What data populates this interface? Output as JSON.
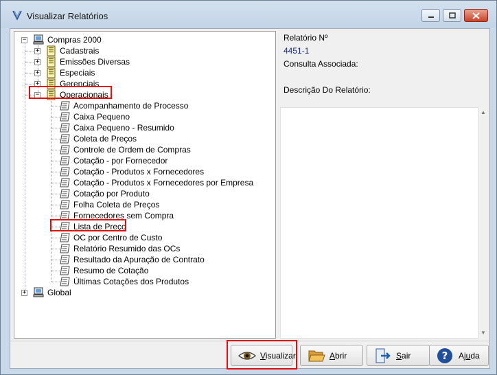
{
  "window": {
    "title": "Visualizar Relatórios"
  },
  "tree": {
    "root": {
      "label": "Compras 2000",
      "expander": "−"
    },
    "categories": [
      {
        "label": "Cadastrais",
        "expander": "+"
      },
      {
        "label": "Emissões Diversas",
        "expander": "+"
      },
      {
        "label": "Especiais",
        "expander": "+"
      },
      {
        "label": "Gerenciais",
        "expander": "+"
      },
      {
        "label": "Operacionais",
        "expander": "−",
        "highlighted": true
      }
    ],
    "reports": [
      "Acompanhamento de Processo",
      "Caixa Pequeno",
      "Caixa Pequeno - Resumido",
      "Coleta de Preços",
      "Controle de Ordem de Compras",
      "Cotação - por Fornecedor",
      "Cotação - Produtos x Fornecedores",
      "Cotação - Produtos x Fornecedores por Empresa",
      "Cotação por Produto",
      "Folha Coleta de Preços",
      "Fornecedores sem Compra",
      "Lista de Preço",
      "OC por Centro de Custo",
      "Relatório Resumido das OCs",
      "Resultado da Apuração de Contrato",
      "Resumo de Cotação",
      "Últimas Cotações dos Produtos"
    ],
    "selected_report": "Lista de Preço",
    "global": {
      "label": "Global",
      "expander": "+"
    }
  },
  "details": {
    "report_number_label": "Relatório Nº",
    "report_number_value": "4451-1",
    "query_label": "Consulta Associada:",
    "description_label": "Descrição Do Relatório:"
  },
  "buttons": {
    "visualizar": {
      "underline": "V",
      "rest": "isualizar"
    },
    "abrir": {
      "underline": "A",
      "rest": "brir"
    },
    "sair": {
      "underline": "S",
      "rest": "air"
    },
    "ajuda": {
      "pre": "Aj",
      "underline": "u",
      "rest": "da"
    }
  },
  "colors": {
    "highlight_border": "#e01010",
    "report_number": "#1a2a7c"
  }
}
